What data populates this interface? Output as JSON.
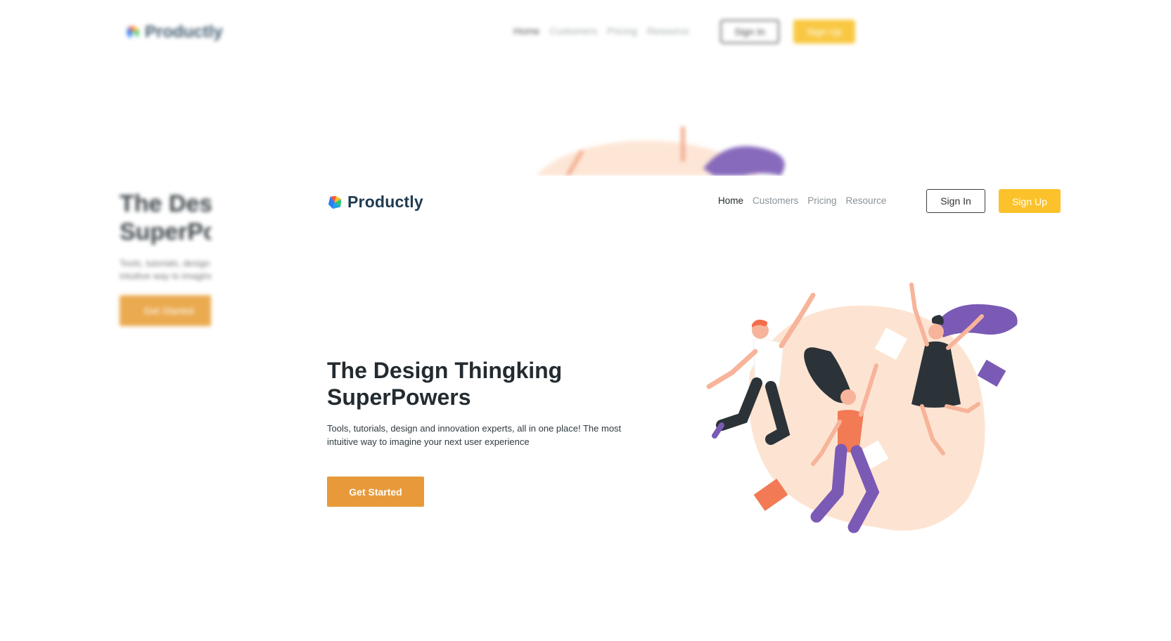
{
  "brand": {
    "name": "Productly"
  },
  "nav": {
    "items": [
      {
        "label": "Home",
        "active": true
      },
      {
        "label": "Customers",
        "active": false
      },
      {
        "label": "Pricing",
        "active": false
      },
      {
        "label": "Resource",
        "active": false
      }
    ]
  },
  "auth": {
    "sign_in": "Sign In",
    "sign_up": "Sign Up"
  },
  "hero": {
    "title_line1": "The Design Thingking",
    "title_line2": "SuperPowers",
    "subtitle_line1": "Tools, tutorials, design and innovation experts, all in one place! The most",
    "subtitle_line2": "intuitive way to imagine your next user experience",
    "cta": "Get Started"
  },
  "colors": {
    "accent_yellow": "#fbc22c",
    "cta_orange": "#e89a3a",
    "text_dark": "#232b30",
    "brand_navy": "#1f3a50",
    "blob_peach": "#fde4d2",
    "purple": "#7b5ab5",
    "coral": "#f27a55"
  },
  "icons": {
    "logo": "productly-logo-icon"
  }
}
